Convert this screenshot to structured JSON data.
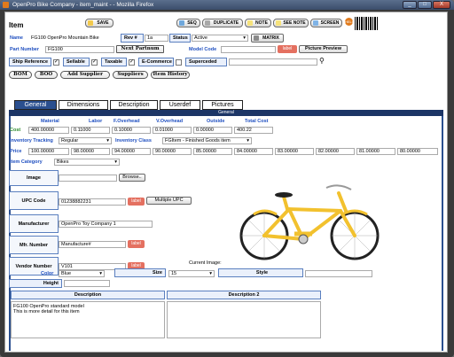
{
  "window": {
    "title": "OpenPro Bike Company - item_maint - - Mozilla Firefox",
    "min": "_",
    "max": "□",
    "close": "X"
  },
  "page": {
    "title": "Item"
  },
  "toolbar": {
    "save": "SAVE",
    "seq": "SEQ",
    "duplicate": "DUPLICATE",
    "note": "NOTE",
    "see_note": "SEE NOTE",
    "screen": "SCREEN",
    "help": "HELP"
  },
  "header": {
    "name_label": "Name",
    "name_value": "FG100 OpenPro Mountain Bike",
    "rev_label": "Rev #",
    "rev_value": "1a",
    "status_label": "Status",
    "status_value": "Active",
    "matrix": "MATRIX",
    "part_label": "Part Number",
    "part_value": "FG100",
    "next_part": "Next Partnum",
    "model_label": "Model Code",
    "model_value": "",
    "label_btn": "label",
    "picture_preview": "Picture Preview"
  },
  "flags": {
    "ship": "Ship Reference",
    "sellable": "Sellable",
    "taxable": "Taxable",
    "ecommerce": "E-Commerce",
    "superceded": "Superceded",
    "check": "✓"
  },
  "actions": {
    "bom": "BOM",
    "boo": "BOO",
    "add_supplier": "Add Supplier",
    "suppliers": "Suppliers",
    "item_history": "Item History"
  },
  "tabs": [
    "General",
    "Dimensions",
    "Description",
    "Userdef",
    "Pictures"
  ],
  "general": {
    "bar": "General",
    "cost_headers": [
      "Material",
      "Labor",
      "F.Overhead",
      "V.Overhead",
      "Outside",
      "Total Cost"
    ],
    "cost_label": "Cost",
    "cost_values": [
      "400.00000",
      "0.11000",
      "0.10000",
      "0.01000",
      "0.00000",
      "400.22"
    ],
    "inv_tracking_label": "Inventory Tracking",
    "inv_tracking_value": "Regular",
    "inv_class_label": "Inventory Class",
    "inv_class_value": "FGItem - Finished Goods item",
    "price_label": "Price",
    "prices": [
      "100.00000",
      "98.00000",
      "94.00000",
      "90.00000",
      "85.00000",
      "84.00000",
      "83.00000",
      "82.00000",
      "81.00000",
      "80.00000"
    ],
    "category_label": "Item Category",
    "category_value": "Bikes",
    "image_label": "Image",
    "browse": "Browse..",
    "upc_label": "UPC Code",
    "upc_value": "01238882231",
    "multiple_upc": "Multiple UPC",
    "manufacturer_label": "Manufacturer",
    "manufacturer_value": "OpenPro Toy Company 1",
    "mfr_number_label": "Mfr. Number",
    "mfr_number_value": "Manufacture#",
    "vendor_label": "Vendor Number",
    "vendor_value": "V101",
    "current_image": "Current Image:",
    "color_label": "Color",
    "color_value": "Blue",
    "size_label": "Size",
    "size_value": "15",
    "style_label": "Style",
    "style_value": "",
    "height_label": "Height",
    "height_value": "",
    "description_label": "Description",
    "description2_label": "Description 2",
    "description_value": "FG100 OpenPro standard model\nThis is more detail for this item",
    "description2_value": ""
  }
}
